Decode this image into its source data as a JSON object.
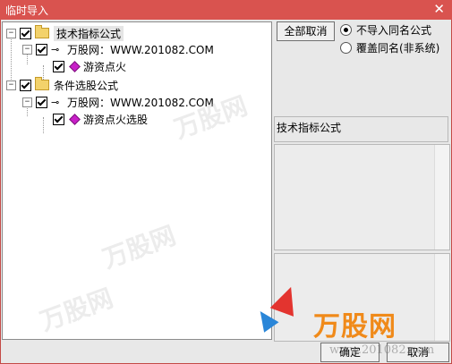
{
  "window": {
    "title": "临时导入",
    "close_symbol": "✕"
  },
  "tree": {
    "groups": [
      {
        "label": "技术指标公式",
        "site": "万股网：WWW.201082.COM",
        "formula": "游资点火"
      },
      {
        "label": "条件选股公式",
        "site": "万股网：WWW.201082.COM",
        "formula": "游资点火选股"
      }
    ],
    "expand_symbol": "−"
  },
  "controls": {
    "deselect_all": "全部取消",
    "radio_no_import": "不导入同名公式",
    "radio_overwrite": "覆盖同名(非系统)",
    "selected_radio": "radio_no_import"
  },
  "info": {
    "category_label": "技术指标公式"
  },
  "watermark": {
    "brand": "万股网",
    "url": "www.201082.com"
  },
  "footer": {
    "ok": "确定",
    "cancel": "取消"
  },
  "colors": {
    "titlebar": "#d9534f",
    "brand_orange": "#f08a1a"
  }
}
